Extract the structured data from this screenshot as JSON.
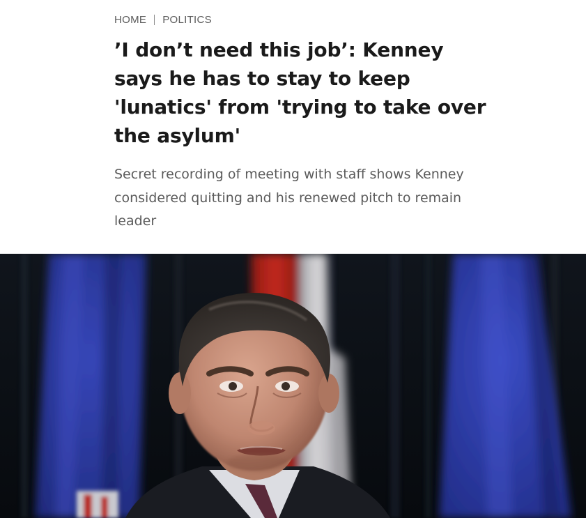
{
  "breadcrumb": {
    "items": [
      {
        "label": "HOME"
      },
      {
        "label": "POLITICS"
      }
    ]
  },
  "article": {
    "headline": "’I don’t need this job’: Kenney says he has to stay to keep 'lunatics' from 'trying to take over the asylum'",
    "subhead": "Secret recording of meeting with staff shows Kenney considered quitting and his renewed pitch to remain leader"
  },
  "colors": {
    "flag_blue": "#2b3aa6",
    "flag_red": "#c0271d",
    "backdrop": "#0b0f14"
  }
}
